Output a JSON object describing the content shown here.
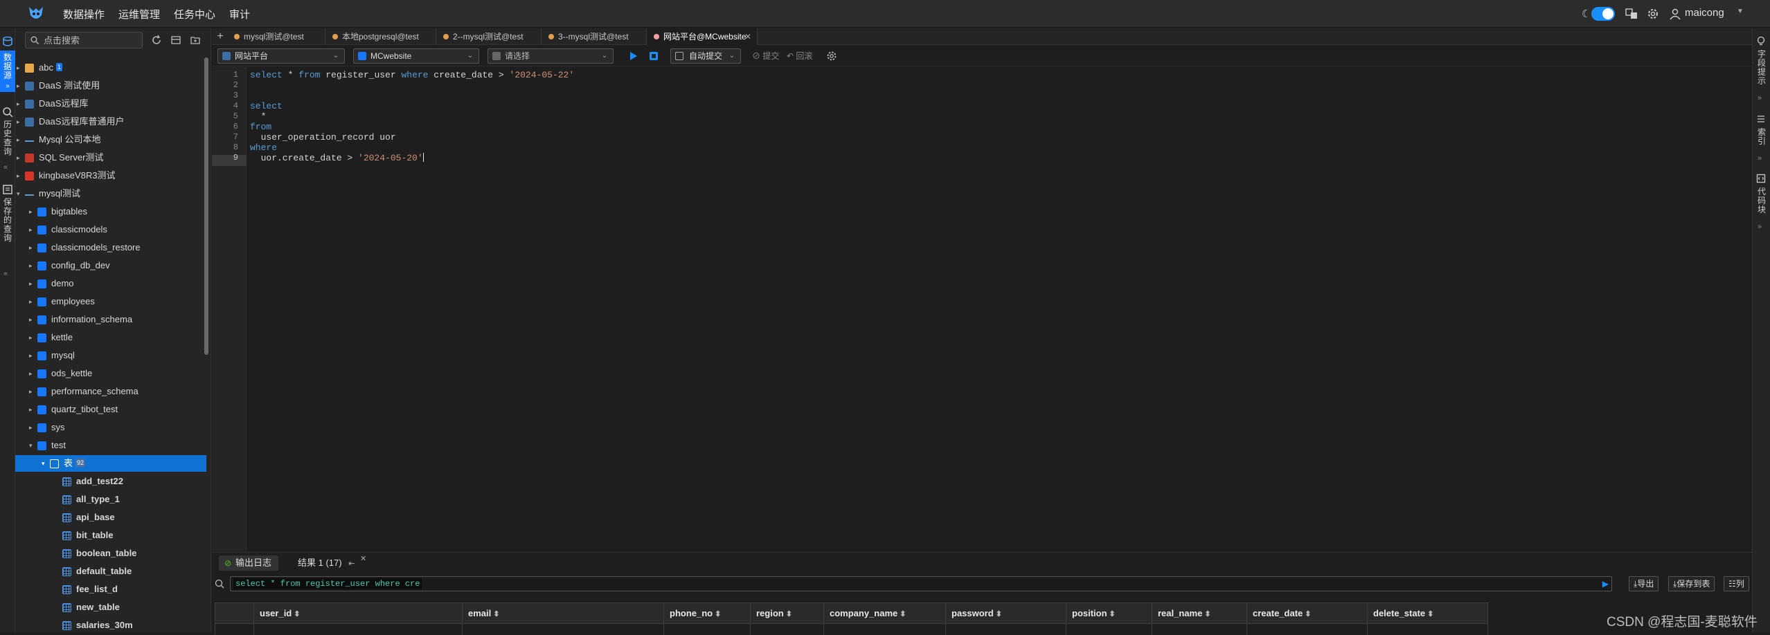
{
  "nav": {
    "menu": [
      "数据操作",
      "运维管理",
      "任务中心",
      "审计"
    ],
    "username": "maicong"
  },
  "left_rail": {
    "tabs": [
      "数据源",
      "历史查询",
      "保存的查询"
    ]
  },
  "sidebar": {
    "search_placeholder": "点击搜索",
    "tree": [
      {
        "label": "abc",
        "badge": "1",
        "icon": "folder-icon",
        "level": 0,
        "arrow": "right"
      },
      {
        "label": "DaaS 测试使用",
        "icon": "daas-icon",
        "level": 0,
        "arrow": "right"
      },
      {
        "label": "DaaS远程库",
        "icon": "daas-icon",
        "level": 0,
        "arrow": "right"
      },
      {
        "label": "DaaS远程库普通用户",
        "icon": "daas-icon",
        "level": 0,
        "arrow": "right"
      },
      {
        "label": "Mysql 公司本地",
        "icon": "mysql-icon",
        "level": 0,
        "arrow": "right"
      },
      {
        "label": "SQL Server测试",
        "icon": "sqlserver-icon",
        "level": 0,
        "arrow": "right"
      },
      {
        "label": "kingbaseV8R3测试",
        "icon": "kingbase-icon",
        "level": 0,
        "arrow": "right"
      },
      {
        "label": "mysql测试",
        "icon": "mysql-icon",
        "level": 0,
        "arrow": "down"
      },
      {
        "label": "bigtables",
        "icon": "database-icon",
        "level": 1,
        "arrow": "right"
      },
      {
        "label": "classicmodels",
        "icon": "database-icon",
        "level": 1,
        "arrow": "right"
      },
      {
        "label": "classicmodels_restore",
        "icon": "database-icon",
        "level": 1,
        "arrow": "right"
      },
      {
        "label": "config_db_dev",
        "icon": "database-icon",
        "level": 1,
        "arrow": "right"
      },
      {
        "label": "demo",
        "icon": "database-icon",
        "level": 1,
        "arrow": "right"
      },
      {
        "label": "employees",
        "icon": "database-icon",
        "level": 1,
        "arrow": "right"
      },
      {
        "label": "information_schema",
        "icon": "database-icon",
        "level": 1,
        "arrow": "right"
      },
      {
        "label": "kettle",
        "icon": "database-icon",
        "level": 1,
        "arrow": "right"
      },
      {
        "label": "mysql",
        "icon": "database-icon",
        "level": 1,
        "arrow": "right"
      },
      {
        "label": "ods_kettle",
        "icon": "database-icon",
        "level": 1,
        "arrow": "right"
      },
      {
        "label": "performance_schema",
        "icon": "database-icon",
        "level": 1,
        "arrow": "right"
      },
      {
        "label": "quartz_tibot_test",
        "icon": "database-icon",
        "level": 1,
        "arrow": "right"
      },
      {
        "label": "sys",
        "icon": "database-icon",
        "level": 1,
        "arrow": "right"
      },
      {
        "label": "test",
        "icon": "database-icon",
        "level": 1,
        "arrow": "down"
      },
      {
        "label": "表",
        "badge": "92",
        "icon": "table-folder-icon",
        "level": 2,
        "arrow": "down",
        "selected": true
      },
      {
        "label": "add_test22",
        "icon": "table-icon",
        "level": 3
      },
      {
        "label": "all_type_1",
        "icon": "table-icon",
        "level": 3
      },
      {
        "label": "api_base",
        "icon": "table-icon",
        "level": 3
      },
      {
        "label": "bit_table",
        "icon": "table-icon",
        "level": 3
      },
      {
        "label": "boolean_table",
        "icon": "table-icon",
        "level": 3
      },
      {
        "label": "default_table",
        "icon": "table-icon",
        "level": 3
      },
      {
        "label": "fee_list_d",
        "icon": "table-icon",
        "level": 3
      },
      {
        "label": "new_table",
        "icon": "table-icon",
        "level": 3
      },
      {
        "label": "salaries_30m",
        "icon": "table-icon",
        "level": 3
      }
    ]
  },
  "tabs": [
    {
      "label": "mysql测试@test",
      "active": false
    },
    {
      "label": "本地postgresql@test",
      "active": false
    },
    {
      "label": "2--mysql测试@test",
      "active": false
    },
    {
      "label": "3--mysql测试@test",
      "active": false
    },
    {
      "label": "网站平台@MCwebsite",
      "active": true
    }
  ],
  "toolbar": {
    "datasource": "网站平台",
    "database": "MCwebsite",
    "schema_placeholder": "请选择",
    "commit_mode": "自动提交",
    "commit_label": "提交",
    "rollback_label": "回滚"
  },
  "editor": {
    "current_line": 9,
    "lines": [
      {
        "n": "1",
        "tokens": [
          {
            "t": "select",
            "c": "kw"
          },
          {
            "t": " * "
          },
          {
            "t": "from",
            "c": "kw"
          },
          {
            "t": " register_user "
          },
          {
            "t": "where",
            "c": "kw"
          },
          {
            "t": " create_date > "
          },
          {
            "t": "'2024-05-22'",
            "c": "str"
          }
        ]
      },
      {
        "n": "2",
        "tokens": []
      },
      {
        "n": "3",
        "tokens": []
      },
      {
        "n": "4",
        "tokens": [
          {
            "t": "select",
            "c": "kw"
          }
        ]
      },
      {
        "n": "5",
        "tokens": [
          {
            "t": "  *"
          }
        ]
      },
      {
        "n": "6",
        "tokens": [
          {
            "t": "from",
            "c": "kw"
          }
        ]
      },
      {
        "n": "7",
        "tokens": [
          {
            "t": "  user_operation_record uor"
          }
        ]
      },
      {
        "n": "8",
        "tokens": [
          {
            "t": "where",
            "c": "kw"
          }
        ]
      },
      {
        "n": "9",
        "tokens": [
          {
            "t": "  uor.create_date > "
          },
          {
            "t": "'2024-05-20'",
            "c": "str"
          }
        ]
      }
    ]
  },
  "bottom": {
    "tab_log": "输出日志",
    "tab_result": "结果 1 (17)",
    "filter_text": "select * from register_user where cre",
    "export_label": "导出",
    "save_table_label": "保存到表",
    "columns_label": "列",
    "columns": [
      "user_id",
      "email",
      "phone_no",
      "region",
      "company_name",
      "password",
      "position",
      "real_name",
      "create_date",
      "delete_state"
    ]
  },
  "right_rail": {
    "tabs": [
      "字段提示",
      "索引",
      "代码块"
    ]
  },
  "watermark": "CSDN @程志国-麦聪软件",
  "colors": {
    "accent": "#1677ff",
    "selected_row": "#1072d3",
    "keyword": "#569cd6",
    "string": "#ce9178"
  }
}
